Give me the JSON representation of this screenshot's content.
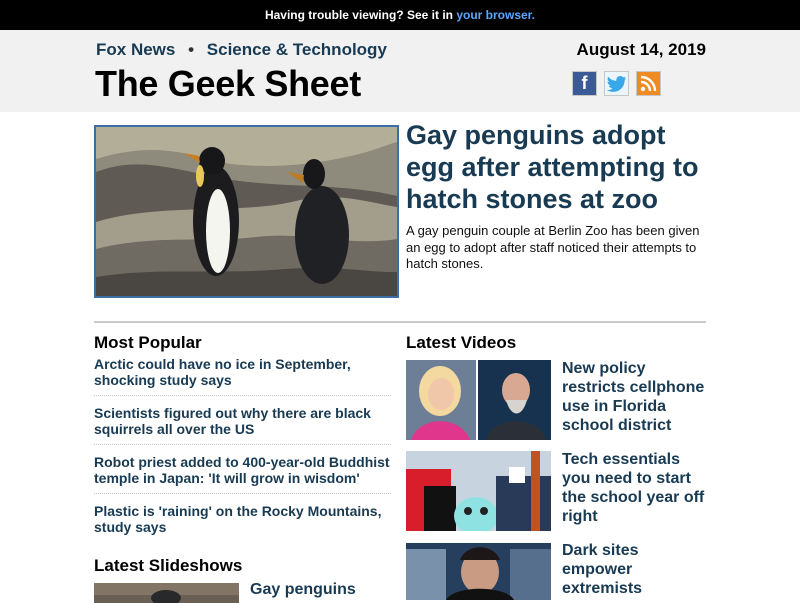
{
  "topbar": {
    "prefix": "Having trouble viewing? See it in ",
    "link": "your browser."
  },
  "masthead": {
    "breadcrumb": [
      "Fox News",
      "Science & Technology"
    ],
    "separator": "•",
    "title": "The Geek Sheet",
    "date": "August 14, 2019",
    "social": [
      {
        "name": "facebook-icon",
        "glyph": "f"
      },
      {
        "name": "twitter-icon",
        "glyph": ""
      },
      {
        "name": "rss-icon",
        "glyph": ""
      }
    ]
  },
  "hero": {
    "headline": "Gay penguins adopt egg after attempting to hatch stones at zoo",
    "summary": "A gay penguin couple at Berlin Zoo has been given an egg to adopt after staff noticed their attempts to hatch stones.",
    "image_icon": "penguins-photo"
  },
  "most_popular": {
    "heading": "Most Popular",
    "items": [
      "Arctic could have no ice in September, shocking study says",
      "Scientists figured out why there are black squirrels all over the US",
      "Robot priest added to 400-year-old Buddhist temple in Japan: 'It will grow in wisdom'",
      "Plastic is 'raining' on the Rocky Mountains, study says"
    ]
  },
  "latest_videos": {
    "heading": "Latest Videos",
    "items": [
      {
        "title": "New policy restricts cellphone use in Florida school district"
      },
      {
        "title": "Tech essentials you need to start the school year off right"
      },
      {
        "title": "Dark sites empower extremists"
      }
    ]
  },
  "latest_slideshows": {
    "heading": "Latest Slideshows",
    "items": [
      {
        "title": "Gay penguins"
      }
    ]
  },
  "colors": {
    "link_blue": "#183a52",
    "top_link": "#5aa7ff",
    "hero_border": "#3b6ea5"
  }
}
